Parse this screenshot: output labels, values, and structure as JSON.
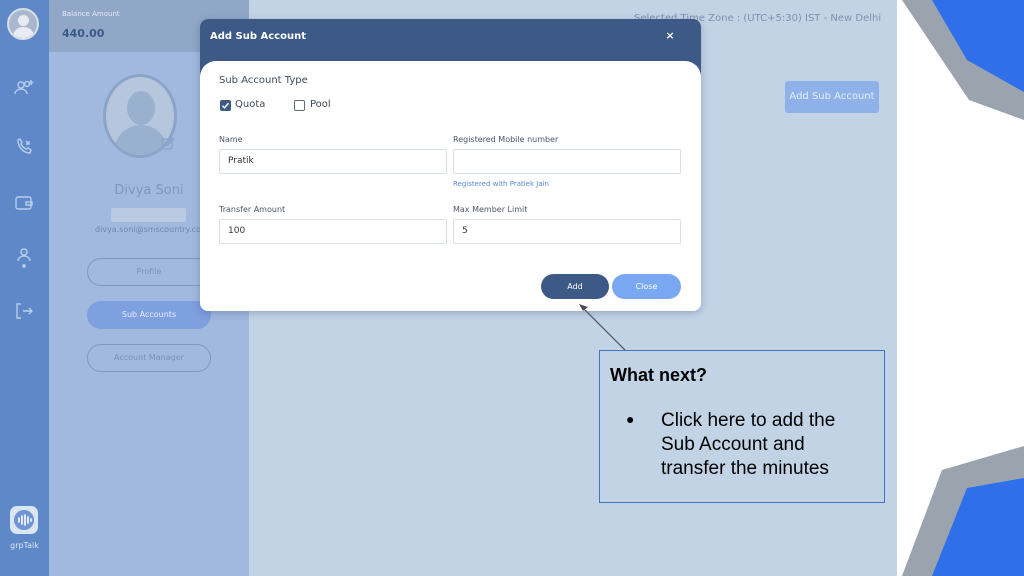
{
  "header": {
    "balance_label": "Balance Amount",
    "balance_value": "440.00",
    "timezone_text": "Selected Time Zone :   (UTC+5:30) IST - New Delhi"
  },
  "nav": {
    "icons": [
      "user-avatar",
      "add-users-icon",
      "phone-call-icon",
      "wallet-icon",
      "person-icon",
      "logout-icon"
    ],
    "logo_label": "grpTalk"
  },
  "profile": {
    "name": "Divya Soni",
    "email": "divya.soni@smscountry.com",
    "buttons": [
      "Profile",
      "Sub Accounts",
      "Account Manager"
    ]
  },
  "main": {
    "add_sub_account_label": "Add Sub Account"
  },
  "modal": {
    "title": "Add Sub Account",
    "close_glyph": "×",
    "sub_account_type_label": "Sub Account Type",
    "types": [
      {
        "label": "Quota",
        "checked": true
      },
      {
        "label": "Pool",
        "checked": false
      }
    ],
    "fields": {
      "name": {
        "label": "Name",
        "value": "Pratik"
      },
      "mobile": {
        "label": "Registered Mobile number",
        "value": "",
        "helper": "Registered with Pratiek Jain"
      },
      "transfer": {
        "label": "Transfer Amount",
        "value": "100"
      },
      "max_member": {
        "label": "Max Member Limit",
        "value": "5"
      }
    },
    "add_label": "Add",
    "close_label": "Close"
  },
  "callout": {
    "title": "What next?",
    "bullet": "●",
    "text": "Click here to add the Sub Account and transfer the minutes"
  },
  "colors": {
    "primary": "#3c5a85",
    "accent": "#7aa7f2",
    "rail": "#5f88c9",
    "callout_border": "#4472c4",
    "deco_blue": "#2f6fea",
    "deco_gray": "#9aa3ae"
  }
}
